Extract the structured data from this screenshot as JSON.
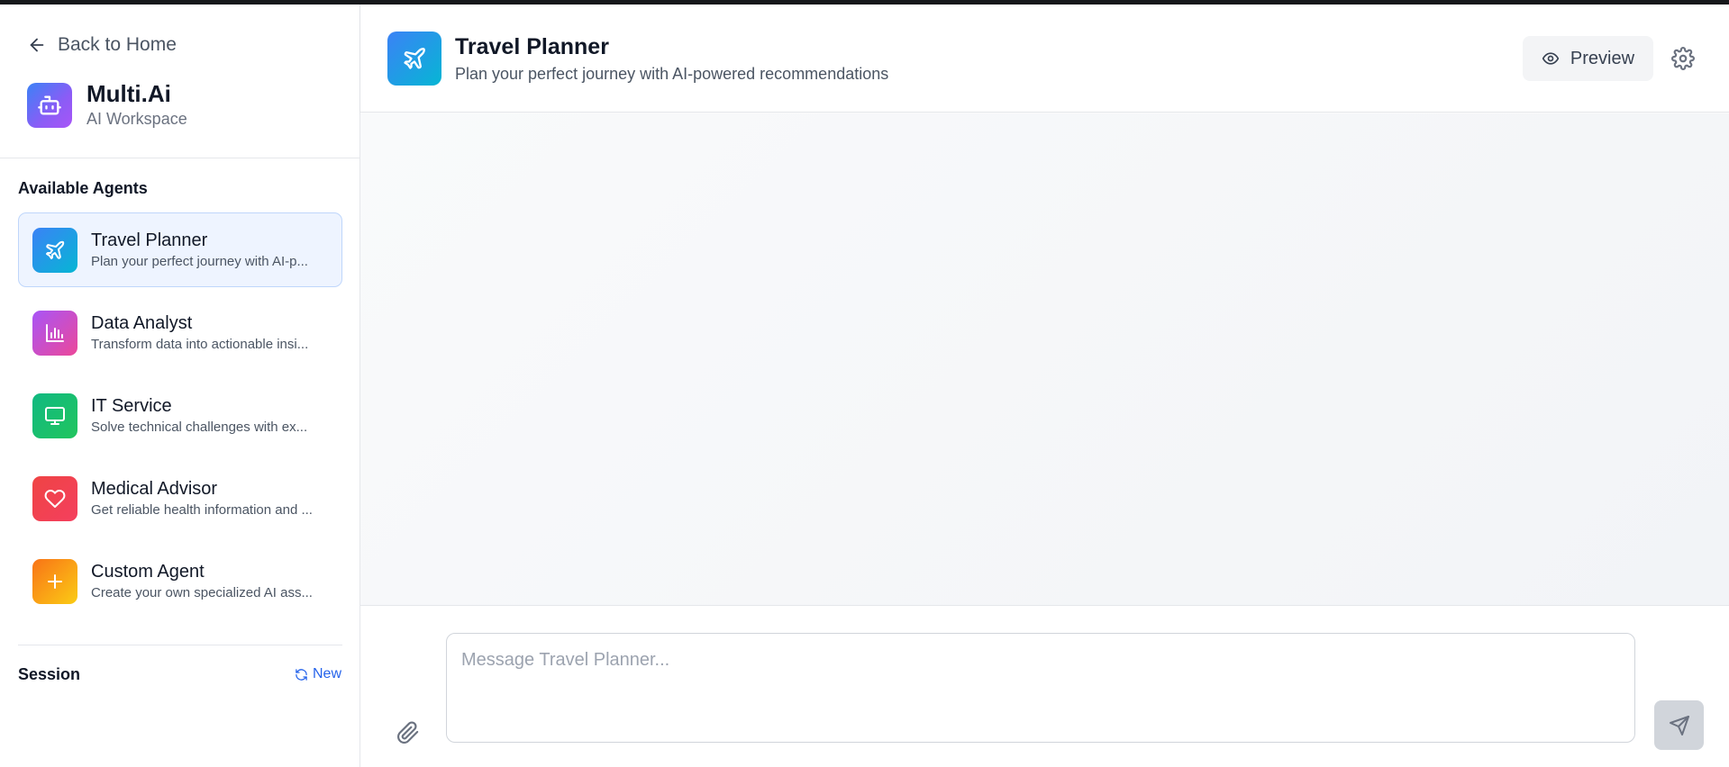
{
  "sidebar": {
    "back_label": "Back to Home",
    "brand": {
      "title": "Multi.Ai",
      "subtitle": "AI Workspace"
    },
    "agents_title": "Available Agents",
    "agents": [
      {
        "name": "Travel Planner",
        "desc": "Plan your perfect journey with AI-p...",
        "icon": "plane-icon",
        "color": "#3b82f6",
        "active": true
      },
      {
        "name": "Data Analyst",
        "desc": "Transform data into actionable insi...",
        "icon": "bar-chart-icon",
        "color": "#a855f7",
        "active": false
      },
      {
        "name": "IT Service",
        "desc": "Solve technical challenges with ex...",
        "icon": "monitor-icon",
        "color": "#10b981",
        "active": false
      },
      {
        "name": "Medical Advisor",
        "desc": "Get reliable health information and ...",
        "icon": "heart-icon",
        "color": "#ef4444",
        "active": false
      },
      {
        "name": "Custom Agent",
        "desc": "Create your own specialized AI ass...",
        "icon": "plus-icon",
        "color": "#f59e0b",
        "active": false
      }
    ],
    "session_title": "Session",
    "new_label": "New"
  },
  "header": {
    "title": "Travel Planner",
    "subtitle": "Plan your perfect journey with AI-powered recommendations",
    "preview_label": "Preview"
  },
  "composer": {
    "placeholder": "Message Travel Planner..."
  }
}
